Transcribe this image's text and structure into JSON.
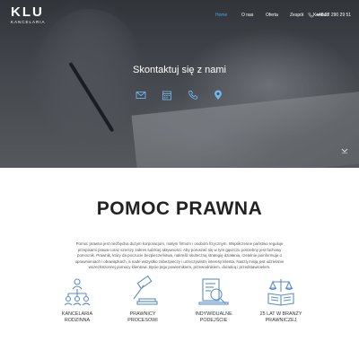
{
  "header": {
    "logo_mark": "KLU",
    "logo_sub": "KANCELARIA",
    "nav": [
      {
        "label": "Home",
        "active": true
      },
      {
        "label": "O nas",
        "active": false
      },
      {
        "label": "Oferta",
        "active": false
      },
      {
        "label": "Zespół",
        "active": false
      },
      {
        "label": "Kontakt",
        "active": false
      }
    ],
    "phone": "+48 22 290 29 51"
  },
  "hero": {
    "title": "Skontaktuj się z nami",
    "icons": [
      "envelope-icon",
      "calendar-icon",
      "phone-icon",
      "location-pin-icon"
    ]
  },
  "main": {
    "title": "POMOC PRAWNA",
    "intro": "Pomoc prawna jest niezbędna dużym korporacjom, małym firmom i osobom fizycznym. Współczesne państwo reguluje przepisami prawa coraz szerszy zakres ludzkiej aktywności. Aby poruszać się w tym gąszczu potrzebny jest fachowy pomocnik. Prawnik, który da poczucie bezpieczeństwa, nakreśli skuteczną strategię działania, rzetelnie poinformuje o uprawnieniach i obowiązkach, a nade wszystko zabezpieczy i urzeczywistni interesy klienta. Naszą misją jest udzielanie wszechstronnej pomocy klientowi. Bycie jego powiernikiem, przewodnikiem, doradcą i przedstawicielem.",
    "features": [
      {
        "label_line1": "KANCELARIA",
        "label_line2": "RODZINNA",
        "icon": "family-tree-icon"
      },
      {
        "label_line1": "PRAWNICY",
        "label_line2": "PROCESOWI",
        "icon": "gavel-icon"
      },
      {
        "label_line1": "INDYWIDUALNE",
        "label_line2": "PODEJŚCIE",
        "icon": "magnifier-document-icon"
      },
      {
        "label_line1": "25 LAT W BRANŻY",
        "label_line2": "PRAWNICZEJ",
        "icon": "scales-book-icon"
      }
    ]
  },
  "colors": {
    "accent": "#4aa3df",
    "icon_blue": "#5b8fc7",
    "title": "#222222"
  }
}
